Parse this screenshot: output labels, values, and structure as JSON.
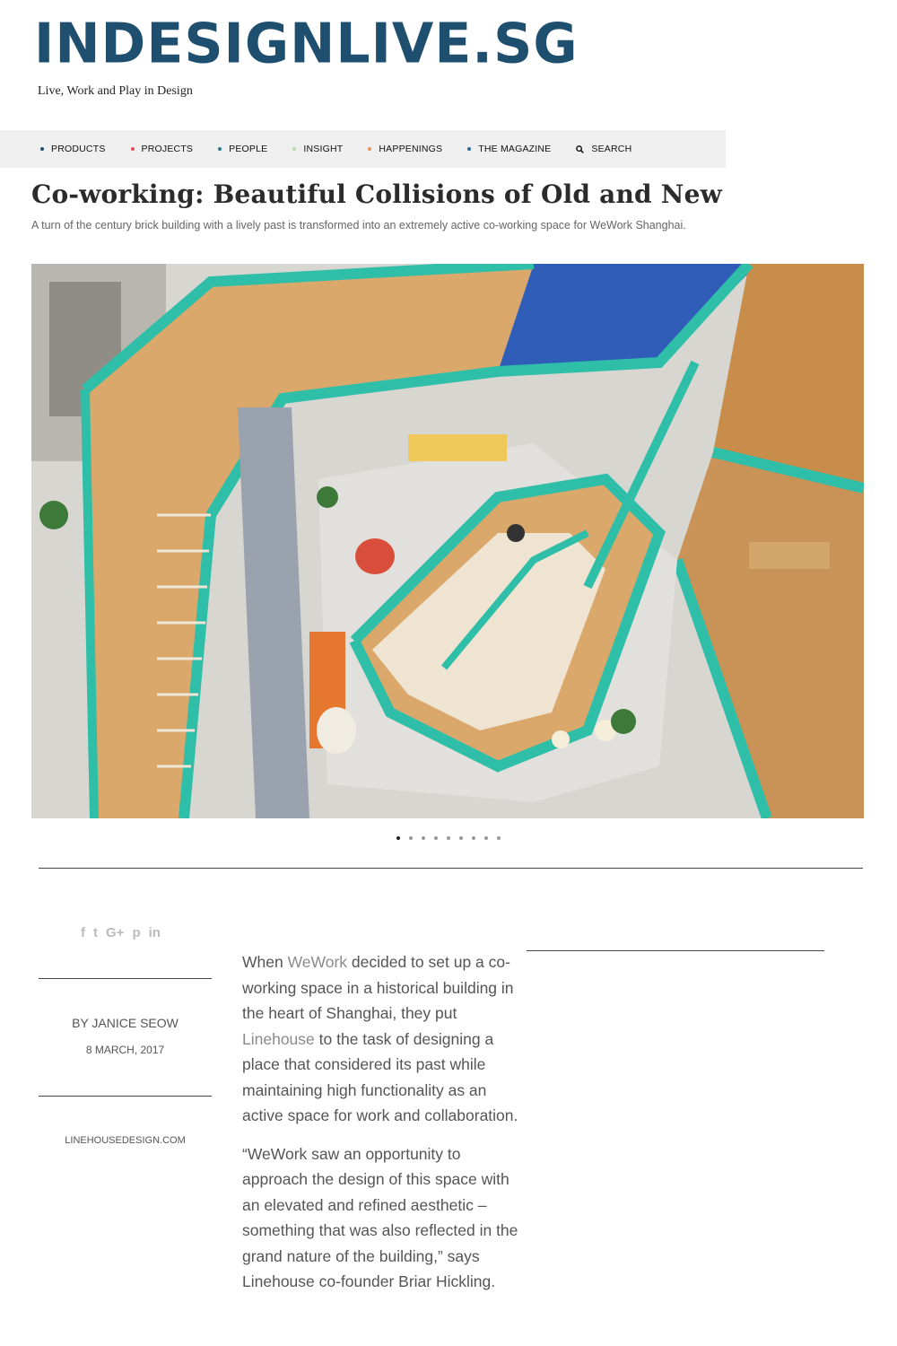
{
  "header": {
    "logo": "INDESIGNLIVE.SG",
    "tagline": "Live, Work and Play in Design"
  },
  "nav": {
    "items": [
      {
        "label": "PRODUCTS",
        "dot_color": "#1f4f6e"
      },
      {
        "label": "PROJECTS",
        "dot_color": "#e0505a"
      },
      {
        "label": "PEOPLE",
        "dot_color": "#2a7a8a"
      },
      {
        "label": "INSIGHT",
        "dot_color": "#b8d8a8"
      },
      {
        "label": "HAPPENINGS",
        "dot_color": "#e8955a"
      },
      {
        "label": "THE MAGAZINE",
        "dot_color": "#2a6a9a"
      }
    ],
    "search": {
      "label": "SEARCH",
      "icon": "search-icon"
    }
  },
  "article": {
    "title": "Co-working: Beautiful Collisions of Old and New",
    "subtitle": "A turn of the century brick building with a lively past is transformed into an extremely active co-working space for WeWork Shanghai.",
    "hero_icon": "staircase-photo",
    "slider": {
      "count": 9,
      "active_index": 0
    },
    "share_icons": [
      "facebook-icon",
      "twitter-icon",
      "google-plus-icon",
      "pinterest-icon",
      "linkedin-icon"
    ],
    "share_glyphs": [
      "f",
      "t",
      "G+",
      "p",
      "in"
    ],
    "byline": "BY JANICE SEOW",
    "date": "8 MARCH, 2017",
    "website": "LINEHOUSEDESIGN.COM",
    "paragraph1": {
      "pre": "When ",
      "link1": "WeWork",
      "mid1": " decided to set up a co-working space in a historical building in the heart of Shanghai, they put ",
      "link2": "Linehouse",
      "post": " to the task of designing a place that considered its past while maintaining high functionality as an active space for work and collaboration."
    },
    "paragraph2": "“WeWork saw an opportunity to approach the design of this space with an elevated and refined aesthetic – something that was also reflected in the grand nature of the building,” says Linehouse co-founder Briar Hickling."
  },
  "colors": {
    "brand": "#1f4f6e",
    "stair_teal": "#2fbfa8",
    "stair_wood": "#d9a86a"
  }
}
